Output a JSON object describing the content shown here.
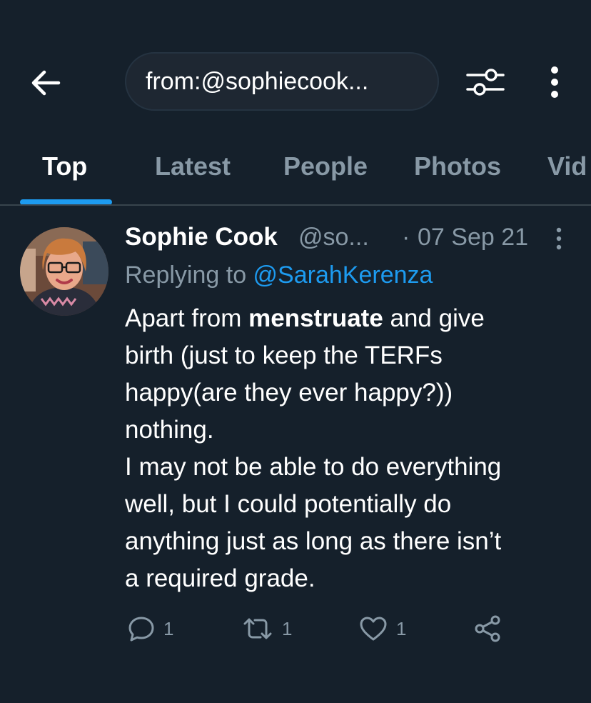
{
  "search": {
    "query": "from:@sophiecook..."
  },
  "tabs": [
    "Top",
    "Latest",
    "People",
    "Photos",
    "Vid"
  ],
  "tweet": {
    "display_name": "Sophie Cook",
    "handle": "@so...",
    "date_sep": "·",
    "date": "07 Sep 21",
    "replying_prefix": "Replying to ",
    "replying_to": "@SarahKerenza",
    "body_lines": [
      [
        "Apart from ",
        "menstruate",
        " and give"
      ],
      "birth (just to keep the TERFs",
      "happy(are they ever happy?))",
      "nothing.",
      "I may not be able to do everything",
      "well, but I could potentially do",
      "anything just as long as there isn’t",
      "a required grade."
    ],
    "counts": {
      "replies": "1",
      "retweets": "1",
      "likes": "1"
    }
  },
  "icons": {
    "back": "arrow-left-icon",
    "filter": "sliders-icon",
    "more": "vertical-ellipsis-icon",
    "reply": "speech-bubble-icon",
    "retweet": "retweet-icon",
    "like": "heart-icon",
    "share": "share-icon"
  },
  "colors": {
    "background": "#15202b",
    "accent": "#1d9bf0",
    "muted": "#8899a6",
    "divider": "#38444d"
  }
}
